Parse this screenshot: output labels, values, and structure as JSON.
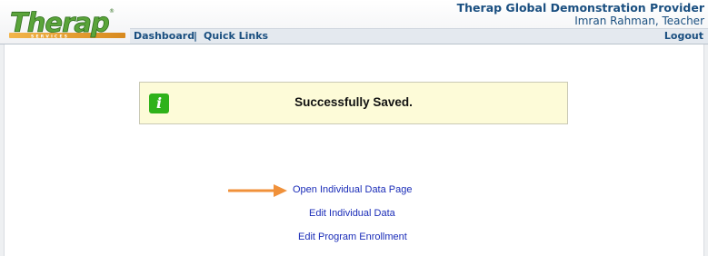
{
  "header": {
    "logo_text": "Therap",
    "logo_tagline": "SERVICES",
    "provider_name": "Therap Global Demonstration Provider",
    "user_name": "Imran Rahman, Teacher"
  },
  "nav": {
    "dashboard_label": "Dashboard",
    "separator": "|",
    "quick_links_label": "Quick Links",
    "logout_label": "Logout"
  },
  "message": {
    "icon": "info-icon",
    "text": "Successfully Saved."
  },
  "links": {
    "open_individual_data_page": "Open Individual Data Page",
    "edit_individual_data": "Edit Individual Data",
    "edit_program_enrollment": "Edit Program Enrollment"
  },
  "colors": {
    "brand_blue": "#1a4f80",
    "link_blue": "#1b2db8",
    "success_green": "#2fb21a",
    "message_bg": "#fdfbd8",
    "arrow_orange": "#f0913a"
  }
}
